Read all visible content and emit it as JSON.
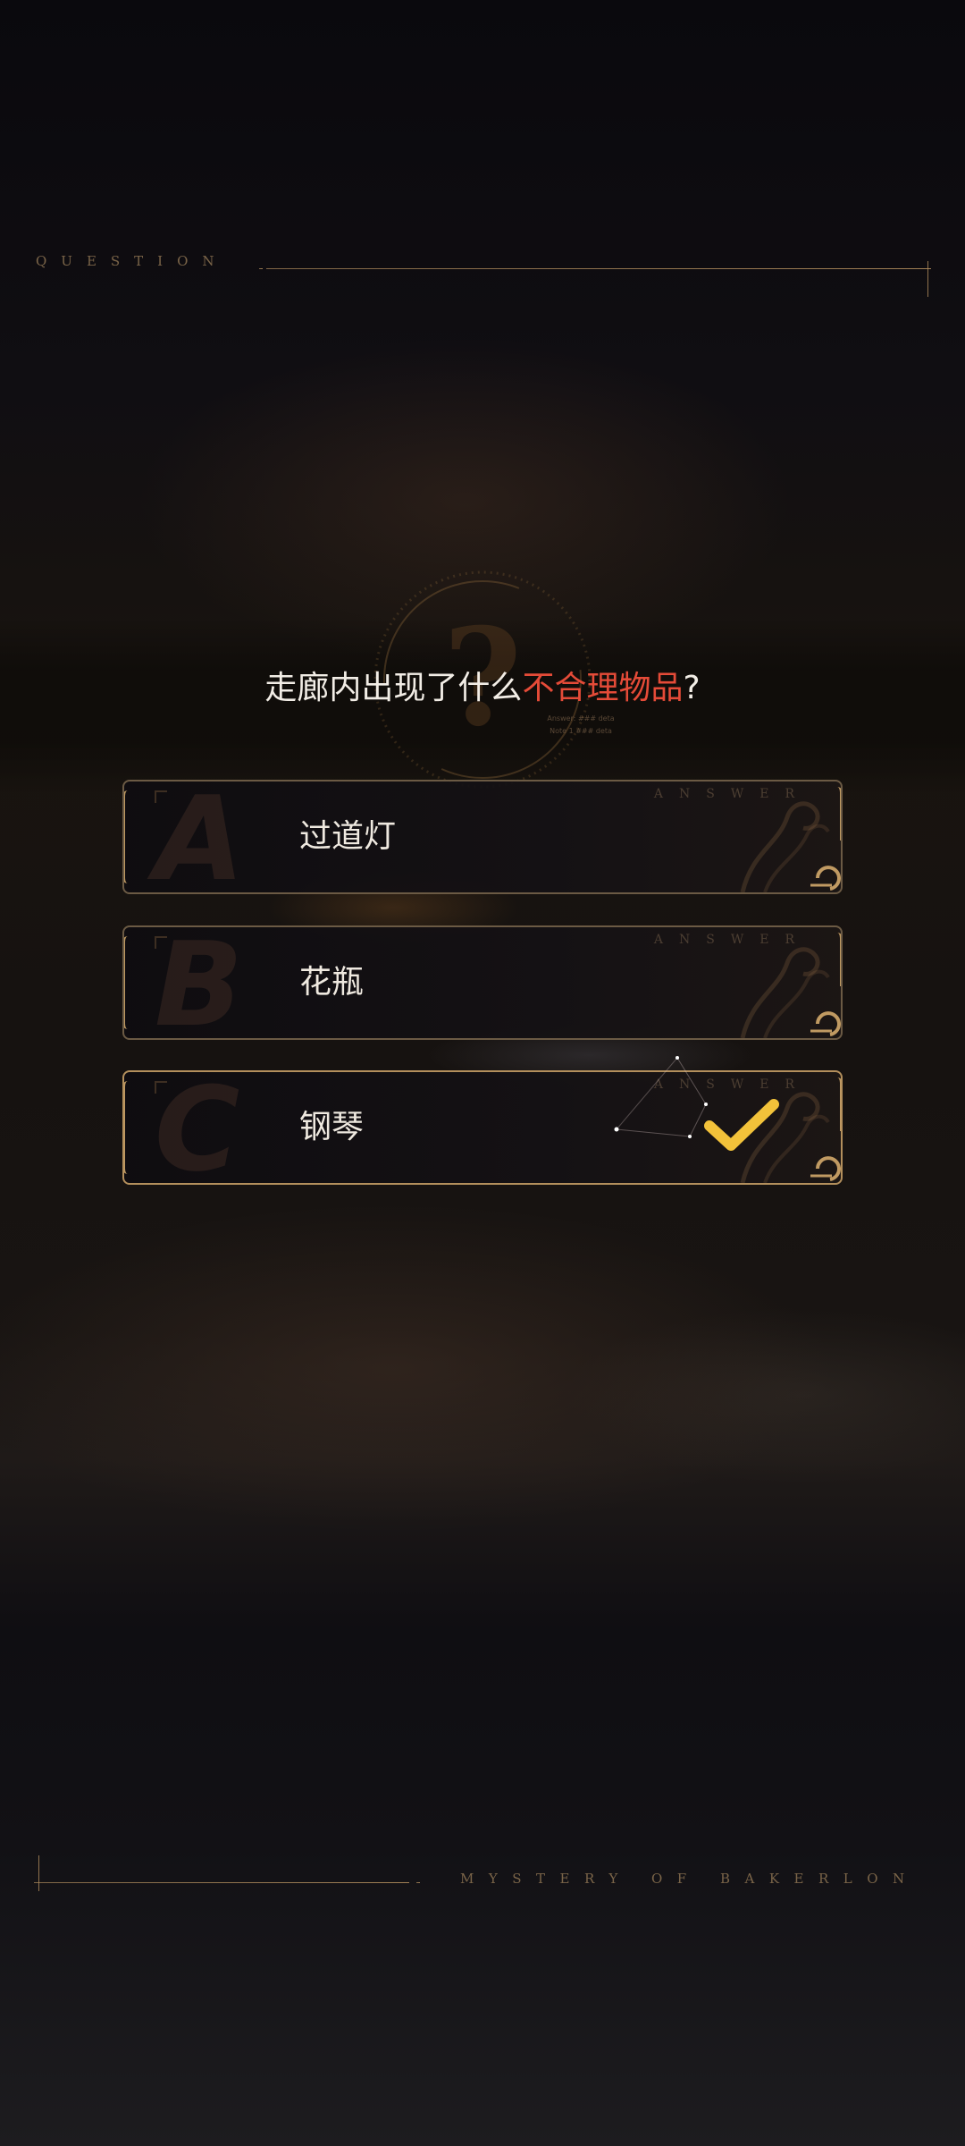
{
  "header": {
    "label": "QUESTION"
  },
  "question": {
    "prefix": "走廊内出现了什么",
    "highlight": "不合理物品",
    "suffix": "?",
    "emblem_small_text_1": "Answer: ### deta",
    "emblem_small_text_2": "Note 1 ### deta"
  },
  "answers": [
    {
      "letter": "A",
      "text": "过道灯",
      "tag": "ANSWER",
      "selected": false
    },
    {
      "letter": "B",
      "text": "花瓶",
      "tag": "ANSWER",
      "selected": false
    },
    {
      "letter": "C",
      "text": "钢琴",
      "tag": "ANSWER",
      "selected": true
    }
  ],
  "footer": {
    "label": "MYSTERY OF BAKERLON"
  },
  "colors": {
    "accent_gold": "#b38f5c",
    "highlight_red": "#e54b38",
    "check_yellow": "#f2c23a",
    "text_primary": "#efe9e0"
  },
  "icons": {
    "check": "check-icon",
    "emblem": "question-mark-emblem-icon",
    "ornament": "filigree-ornament-icon"
  }
}
